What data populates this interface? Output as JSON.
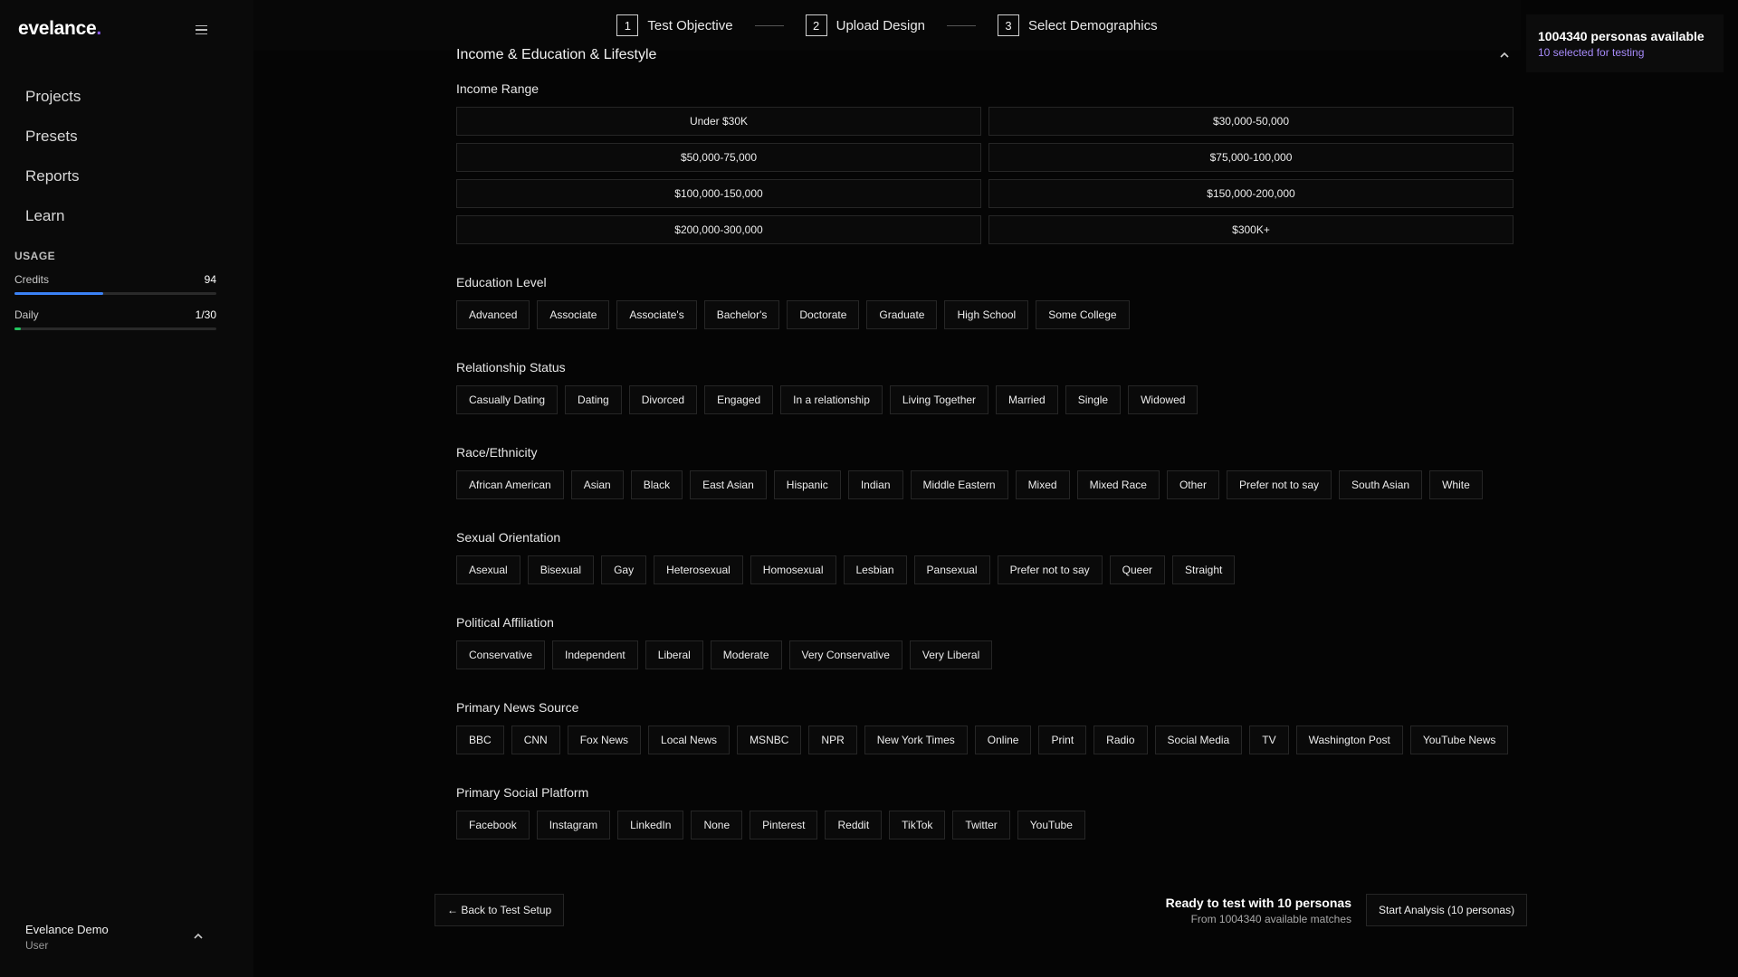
{
  "brand": {
    "name": "evelance",
    "dot": ".",
    "accent": "#8b5cf6"
  },
  "sidebar": {
    "items": [
      {
        "label": "Projects"
      },
      {
        "label": "Presets"
      },
      {
        "label": "Reports"
      },
      {
        "label": "Learn"
      }
    ],
    "usage": {
      "title": "USAGE",
      "credits": {
        "label": "Credits",
        "value": "94",
        "fill_fraction": 0.44
      },
      "daily": {
        "label": "Daily",
        "value": "1/30",
        "fill_fraction": 0.033
      }
    },
    "user": {
      "name": "Evelance Demo",
      "role": "User"
    }
  },
  "stepper": {
    "steps": [
      {
        "num": "1",
        "label": "Test Objective"
      },
      {
        "num": "2",
        "label": "Upload Design"
      },
      {
        "num": "3",
        "label": "Select Demographics"
      }
    ]
  },
  "personas": {
    "count_text": "1004340 personas available",
    "selected_text": "10 selected for testing"
  },
  "section": {
    "title": "Income & Education & Lifestyle",
    "income": {
      "title": "Income Range",
      "options": [
        "Under $30K",
        "$30,000-50,000",
        "$50,000-75,000",
        "$75,000-100,000",
        "$100,000-150,000",
        "$150,000-200,000",
        "$200,000-300,000",
        "$300K+"
      ]
    },
    "groups": [
      {
        "key": "education",
        "title": "Education Level",
        "options": [
          "Advanced",
          "Associate",
          "Associate's",
          "Bachelor's",
          "Doctorate",
          "Graduate",
          "High School",
          "Some College"
        ]
      },
      {
        "key": "relationship",
        "title": "Relationship Status",
        "options": [
          "Casually Dating",
          "Dating",
          "Divorced",
          "Engaged",
          "In a relationship",
          "Living Together",
          "Married",
          "Single",
          "Widowed"
        ]
      },
      {
        "key": "race",
        "title": "Race/Ethnicity",
        "options": [
          "African American",
          "Asian",
          "Black",
          "East Asian",
          "Hispanic",
          "Indian",
          "Middle Eastern",
          "Mixed",
          "Mixed Race",
          "Other",
          "Prefer not to say",
          "South Asian",
          "White"
        ]
      },
      {
        "key": "orientation",
        "title": "Sexual Orientation",
        "options": [
          "Asexual",
          "Bisexual",
          "Gay",
          "Heterosexual",
          "Homosexual",
          "Lesbian",
          "Pansexual",
          "Prefer not to say",
          "Queer",
          "Straight"
        ]
      },
      {
        "key": "political",
        "title": "Political Affiliation",
        "options": [
          "Conservative",
          "Independent",
          "Liberal",
          "Moderate",
          "Very Conservative",
          "Very Liberal"
        ]
      },
      {
        "key": "news",
        "title": "Primary News Source",
        "options": [
          "BBC",
          "CNN",
          "Fox News",
          "Local News",
          "MSNBC",
          "NPR",
          "New York Times",
          "Online",
          "Print",
          "Radio",
          "Social Media",
          "TV",
          "Washington Post",
          "YouTube News"
        ]
      },
      {
        "key": "social",
        "title": "Primary Social Platform",
        "options": [
          "Facebook",
          "Instagram",
          "LinkedIn",
          "None",
          "Pinterest",
          "Reddit",
          "TikTok",
          "Twitter",
          "YouTube"
        ]
      }
    ]
  },
  "footer": {
    "back_label": "← Back to Test Setup",
    "ready_title": "Ready to test with 10 personas",
    "ready_sub": "From 1004340 available matches",
    "start_label": "Start Analysis (10 personas)"
  }
}
